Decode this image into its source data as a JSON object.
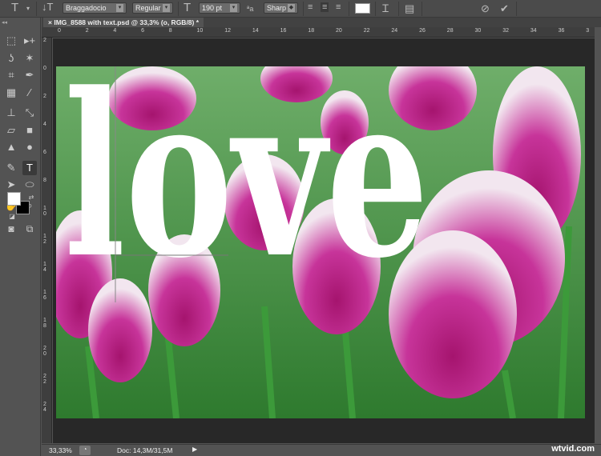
{
  "options_bar": {
    "tool_icon": "type-tool-icon",
    "orientation_icon": "toggle-text-orientation-icon",
    "font_family": "Braggadocio",
    "font_style": "Regular",
    "font_size": "190 pt",
    "antialias_icon": "antialias-icon",
    "antialias": "Sharp",
    "align_left_icon": "align-left-icon",
    "align_center_icon": "align-center-icon",
    "align_right_icon": "align-right-icon",
    "text_color": "#ffffff",
    "warp_icon": "warp-text-icon",
    "panels_icon": "character-panels-icon",
    "cancel_icon": "cancel-icon",
    "commit_icon": "commit-checkmark-icon"
  },
  "document_tab": {
    "title": "IMG_8588 with text.psd @ 33,3% (o, RGB/8) *",
    "close": "×"
  },
  "rulers": {
    "horizontal": [
      "0",
      "2",
      "4",
      "6",
      "8",
      "10",
      "12",
      "14",
      "16",
      "18",
      "20",
      "22",
      "24",
      "26",
      "28",
      "30",
      "32",
      "34",
      "36",
      "3"
    ],
    "vertical": [
      "2",
      "0",
      "2",
      "4",
      "6",
      "8",
      "10",
      "12",
      "14",
      "16",
      "18",
      "20",
      "22",
      "24"
    ]
  },
  "canvas": {
    "text_layer": "love"
  },
  "toolbar": {
    "tools": [
      "marquee",
      "move",
      "lasso",
      "magic-wand",
      "crop",
      "eyedropper",
      "healing",
      "brush",
      "clone-stamp",
      "history-brush",
      "eraser",
      "gradient",
      "blur",
      "dodge",
      "pen",
      "type",
      "path-selection",
      "ellipse",
      "hand",
      "zoom"
    ],
    "foreground_color": "#ffffff",
    "background_color": "#000000"
  },
  "status_bar": {
    "zoom": "33,33%",
    "doc_info": "Doc: 14,3M/31,5M"
  },
  "watermark": "wtvid.com"
}
